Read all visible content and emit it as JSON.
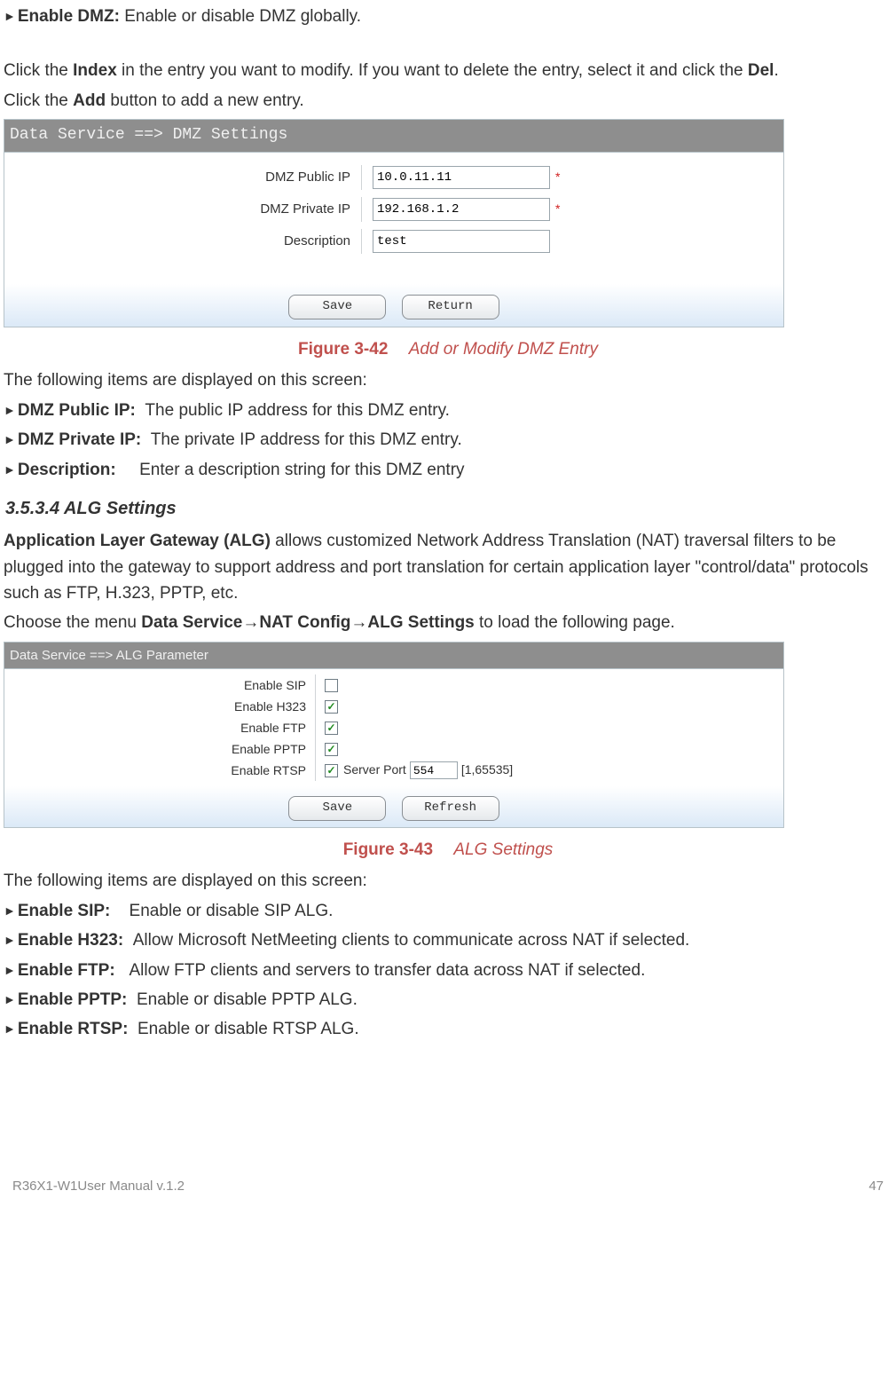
{
  "intro": {
    "l1_label": "Enable DMZ:",
    "l1_desc": "Enable or disable DMZ globally.",
    "para1_a": "Click the ",
    "para1_b": "Index",
    "para1_c": " in the entry you want to modify. If you want to delete the entry, select it and click the ",
    "para1_d": "Del",
    "para1_e": ".",
    "para2_a": "Click the ",
    "para2_b": "Add",
    "para2_c": " button to add a new entry."
  },
  "fig42": {
    "header": "Data Service ==> DMZ Settings",
    "row1_label": "DMZ Public IP",
    "row1_value": "10.0.11.11",
    "row1_req": "*",
    "row2_label": "DMZ Private IP",
    "row2_value": "192.168.1.2",
    "row2_req": "*",
    "row3_label": "Description",
    "row3_value": "test",
    "btn_save": "Save",
    "btn_return": "Return",
    "caption_label": "Figure 3-42",
    "caption_title": "Add or Modify DMZ Entry"
  },
  "post42": {
    "intro": "The following items are displayed on this screen:",
    "i1_label": "DMZ Public IP:",
    "i1_desc": "The public IP address for this DMZ entry.",
    "i2_label": "DMZ Private IP:",
    "i2_desc": "The private IP address for this DMZ entry.",
    "i3_label": "Description:",
    "i3_desc": "Enter a description string for this DMZ entry"
  },
  "sec3534": {
    "heading": "3.5.3.4  ALG Settings",
    "p1_a": "Application Layer Gateway (ALG)",
    "p1_b": " allows customized Network Address Translation (NAT) traversal filters to be plugged into the gateway to support address and port translation for certain application layer \"control/data\" protocols such as FTP, H.323, PPTP, etc.",
    "p2_a": "Choose the menu ",
    "p2_b": "Data Service",
    "p2_c": "→",
    "p2_d": "NAT Config",
    "p2_e": "→",
    "p2_f": "ALG Settings",
    "p2_g": " to load the following page."
  },
  "fig43": {
    "header": "Data Service ==> ALG Parameter",
    "r1_label": "Enable SIP",
    "r1_checked": "",
    "r2_label": "Enable H323",
    "r2_checked": "✓",
    "r3_label": "Enable FTP",
    "r3_checked": "✓",
    "r4_label": "Enable PPTP",
    "r4_checked": "✓",
    "r5_label": "Enable RTSP",
    "r5_checked": "✓",
    "r5_sp_label": "Server Port",
    "r5_sp_value": "554",
    "r5_sp_range": "[1,65535]",
    "btn_save": "Save",
    "btn_refresh": "Refresh",
    "caption_label": "Figure 3-43",
    "caption_title": "ALG Settings"
  },
  "post43": {
    "intro": "The following items are displayed on this screen:",
    "i1_label": "Enable SIP:",
    "i1_desc": "Enable or disable SIP ALG.",
    "i2_label": "Enable H323:",
    "i2_desc": "Allow Microsoft NetMeeting clients to communicate across NAT if selected.",
    "i3_label": "Enable FTP:",
    "i3_desc": "Allow FTP clients and servers to transfer data across NAT if selected.",
    "i4_label": "Enable PPTP:",
    "i4_desc": "Enable or disable PPTP ALG.",
    "i5_label": "Enable RTSP:",
    "i5_desc": "Enable or disable RTSP ALG."
  },
  "footer": {
    "left": "R36X1-W1User Manual v.1.2",
    "right": "47"
  }
}
